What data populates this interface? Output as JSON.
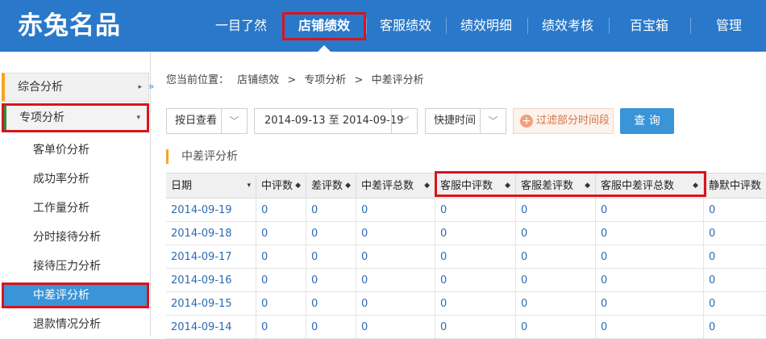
{
  "header": {
    "logo": "赤兔名品",
    "nav": [
      {
        "label": "一目了然"
      },
      {
        "label": "店铺绩效"
      },
      {
        "label": "客服绩效"
      },
      {
        "label": "绩效明细"
      },
      {
        "label": "绩效考核"
      },
      {
        "label": "百宝箱"
      },
      {
        "label": "管理"
      }
    ]
  },
  "sidebar": {
    "groups": [
      {
        "label": "综合分析",
        "caret": "▸"
      },
      {
        "label": "专项分析",
        "caret": "▾"
      }
    ],
    "items": [
      {
        "label": "客单价分析"
      },
      {
        "label": "成功率分析"
      },
      {
        "label": "工作量分析"
      },
      {
        "label": "分时接待分析"
      },
      {
        "label": "接待压力分析"
      },
      {
        "label": "中差评分析"
      },
      {
        "label": "退款情况分析"
      }
    ],
    "collapse_icon": "»"
  },
  "breadcrumb": {
    "prefix": "您当前位置：",
    "parts": [
      "店铺绩效",
      "专项分析",
      "中差评分析"
    ],
    "sep": ">"
  },
  "toolbar": {
    "view_mode": "按日查看",
    "date_range": "2014-09-13 至 2014-09-19",
    "quick_time": "快捷时间",
    "filter_label": "过滤部分时间段",
    "query_label": "查 询",
    "dd_icon": "﹀",
    "plus_icon": "+"
  },
  "section": {
    "title": "中差评分析"
  },
  "table": {
    "columns": [
      {
        "label": "日期",
        "sort": "▾"
      },
      {
        "label": "中评数",
        "sort": "◆"
      },
      {
        "label": "差评数",
        "sort": "◆"
      },
      {
        "label": "中差评总数",
        "sort": "◆"
      },
      {
        "label": "客服中评数",
        "sort": "◆"
      },
      {
        "label": "客服差评数",
        "sort": "◆"
      },
      {
        "label": "客服中差评总数",
        "sort": "◆"
      },
      {
        "label": "静默中评数",
        "sort": ""
      }
    ],
    "rows": [
      [
        "2014-09-19",
        "0",
        "0",
        "0",
        "0",
        "0",
        "0",
        "0"
      ],
      [
        "2014-09-18",
        "0",
        "0",
        "0",
        "0",
        "0",
        "0",
        "0"
      ],
      [
        "2014-09-17",
        "0",
        "0",
        "0",
        "0",
        "0",
        "0",
        "0"
      ],
      [
        "2014-09-16",
        "0",
        "0",
        "0",
        "0",
        "0",
        "0",
        "0"
      ],
      [
        "2014-09-15",
        "0",
        "0",
        "0",
        "0",
        "0",
        "0",
        "0"
      ],
      [
        "2014-09-14",
        "0",
        "0",
        "0",
        "0",
        "0",
        "0",
        "0"
      ]
    ]
  }
}
